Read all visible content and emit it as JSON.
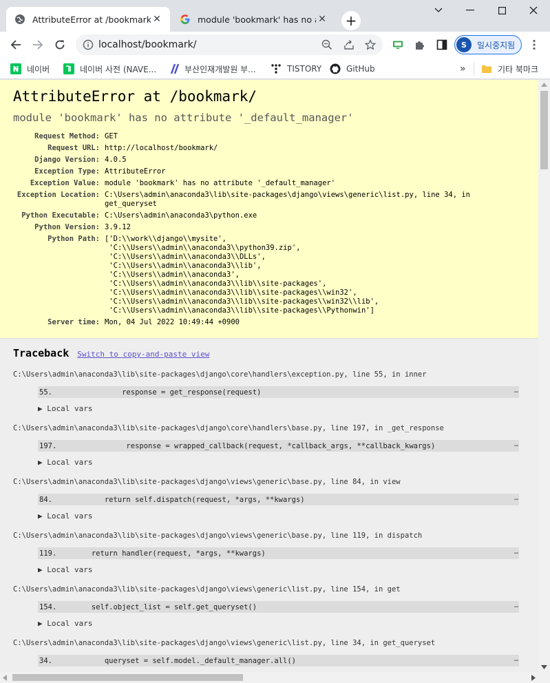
{
  "browser": {
    "tabs": [
      {
        "title": "AttributeError at /bookmark/",
        "close": "✕"
      },
      {
        "title": "module 'bookmark' has no attrib",
        "close": "✕"
      }
    ],
    "new_tab": "+",
    "url": "localhost/bookmark/",
    "profile_initial": "S",
    "profile_label": "일시중지됨",
    "bookmarks": [
      {
        "label": "네이버",
        "icon": "naver-icon"
      },
      {
        "label": "네이버 사전 (NAVE...",
        "icon": "naver-dictionary-icon"
      },
      {
        "label": "부산인재개발원 부...",
        "icon": "slash-logo-icon"
      },
      {
        "label": "TISTORY",
        "icon": "tistory-icon"
      },
      {
        "label": "GitHub",
        "icon": "github-icon"
      }
    ],
    "bookmarks_more": "»",
    "other_bookmarks": "기타 북마크"
  },
  "error": {
    "title": "AttributeError at /bookmark/",
    "subtitle": "module 'bookmark' has no attribute '_default_manager'",
    "meta": [
      {
        "label": "Request Method:",
        "value": "GET"
      },
      {
        "label": "Request URL:",
        "value": "http://localhost/bookmark/"
      },
      {
        "label": "Django Version:",
        "value": "4.0.5"
      },
      {
        "label": "Exception Type:",
        "value": "AttributeError"
      },
      {
        "label": "Exception Value:",
        "value": "module 'bookmark' has no attribute '_default_manager'"
      },
      {
        "label": "Exception Location:",
        "value": "C:\\Users\\admin\\anaconda3\\lib\\site-packages\\django\\views\\generic\\list.py, line 34, in\nget_queryset"
      },
      {
        "label": "Python Executable:",
        "value": "C:\\Users\\admin\\anaconda3\\python.exe"
      },
      {
        "label": "Python Version:",
        "value": "3.9.12"
      },
      {
        "label": "Python Path:",
        "value": "['D:\\\\work\\\\django\\\\mysite',\n 'C:\\\\Users\\\\admin\\\\anaconda3\\\\python39.zip',\n 'C:\\\\Users\\\\admin\\\\anaconda3\\\\DLLs',\n 'C:\\\\Users\\\\admin\\\\anaconda3\\\\lib',\n 'C:\\\\Users\\\\admin\\\\anaconda3',\n 'C:\\\\Users\\\\admin\\\\anaconda3\\\\lib\\\\site-packages',\n 'C:\\\\Users\\\\admin\\\\anaconda3\\\\lib\\\\site-packages\\\\win32',\n 'C:\\\\Users\\\\admin\\\\anaconda3\\\\lib\\\\site-packages\\\\win32\\\\lib',\n 'C:\\\\Users\\\\admin\\\\anaconda3\\\\lib\\\\site-packages\\\\Pythonwin']"
      },
      {
        "label": "Server time:",
        "value": "Mon, 04 Jul 2022 10:49:44 +0900"
      }
    ]
  },
  "traceback": {
    "heading": "Traceback",
    "switch_link": "Switch to copy-and-paste view",
    "local_vars_label": "▶ Local vars",
    "ellipsis": "…",
    "frames": [
      {
        "path": "C:\\Users\\admin\\anaconda3\\lib\\site-packages\\django\\core\\handlers\\exception.py, line 55, in inner",
        "code": "55.                response = get_response(request)"
      },
      {
        "path": "C:\\Users\\admin\\anaconda3\\lib\\site-packages\\django\\core\\handlers\\base.py, line 197, in _get_response",
        "code": "197.                response = wrapped_callback(request, *callback_args, **callback_kwargs)"
      },
      {
        "path": "C:\\Users\\admin\\anaconda3\\lib\\site-packages\\django\\views\\generic\\base.py, line 84, in view",
        "code": "84.            return self.dispatch(request, *args, **kwargs)"
      },
      {
        "path": "C:\\Users\\admin\\anaconda3\\lib\\site-packages\\django\\views\\generic\\base.py, line 119, in dispatch",
        "code": "119.        return handler(request, *args, **kwargs)"
      },
      {
        "path": "C:\\Users\\admin\\anaconda3\\lib\\site-packages\\django\\views\\generic\\list.py, line 154, in get",
        "code": "154.        self.object_list = self.get_queryset()"
      },
      {
        "path": "C:\\Users\\admin\\anaconda3\\lib\\site-packages\\django\\views\\generic\\list.py, line 34, in get_queryset",
        "code": "34.            queryset = self.model._default_manager.all()"
      }
    ]
  },
  "colors": {
    "summary_bg": "#ffffc8",
    "page_bg": "#eeeeee",
    "link": "#5b50c8",
    "profile": "#1a56b0"
  }
}
